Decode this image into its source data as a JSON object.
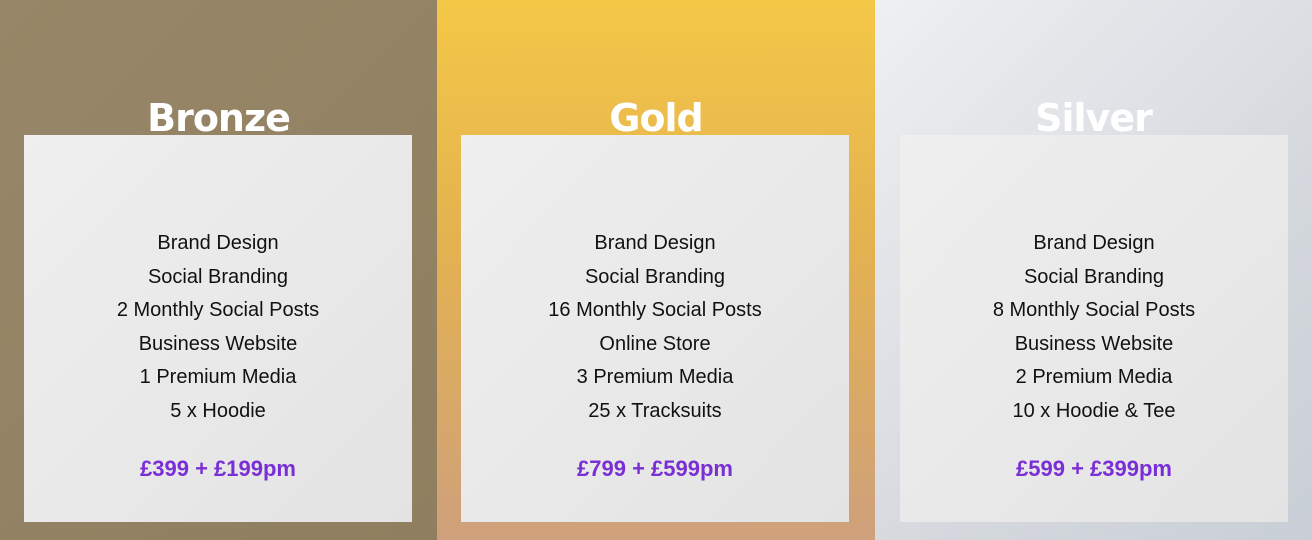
{
  "plans": [
    {
      "name": "Bronze",
      "features": [
        "Brand Design",
        "Social Branding",
        "2 Monthly Social Posts",
        "Business Website",
        "1 Premium Media",
        "5 x Hoodie"
      ],
      "price": "£399 + £199pm"
    },
    {
      "name": "Gold",
      "features": [
        "Brand Design",
        "Social Branding",
        "16 Monthly Social Posts",
        "Online Store",
        "3 Premium Media",
        "25 x Tracksuits"
      ],
      "price": "£799 + £599pm"
    },
    {
      "name": "Silver",
      "features": [
        "Brand Design",
        "Social Branding",
        "8 Monthly Social Posts",
        "Business Website",
        "2 Premium Media",
        "10 x Hoodie & Tee"
      ],
      "price": "£599 + £399pm"
    }
  ],
  "colors": {
    "bronze_bg": "#918160",
    "gold_bg": "#f2c446",
    "silver_bg": "#dadee3",
    "card_bg": "#e9e9e9",
    "price_text": "#7a2fd6",
    "title_text": "#ffffff"
  }
}
